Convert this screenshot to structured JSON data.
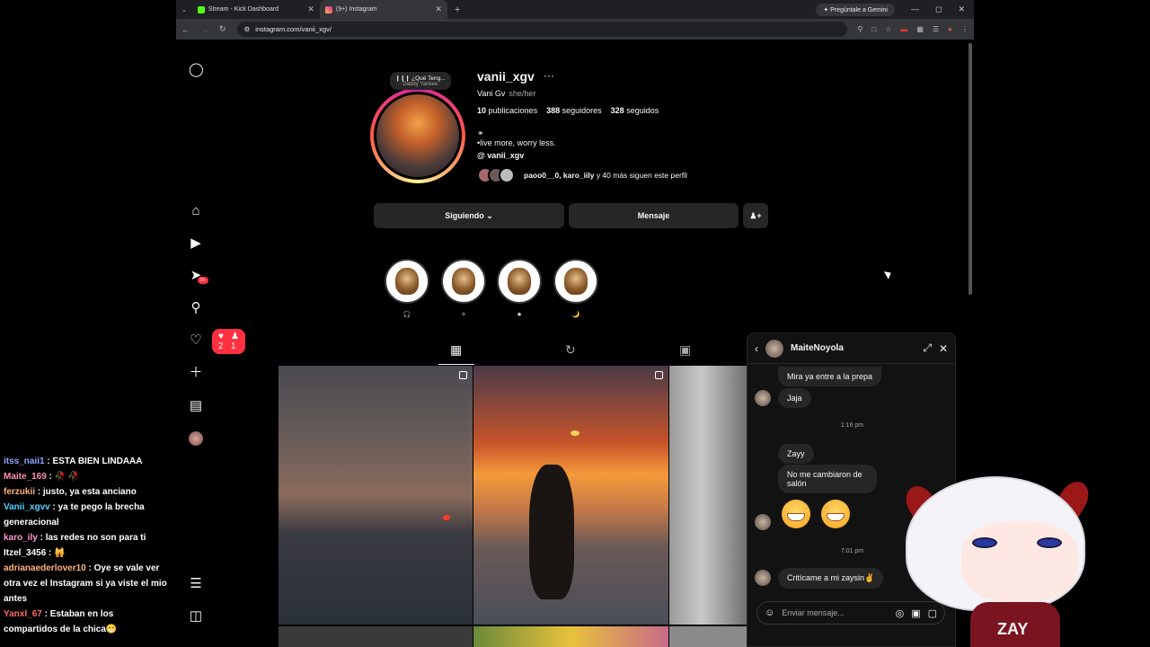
{
  "chat": [
    {
      "user": "itss_naii1",
      "color": "#8fa8ff",
      "text": "ESTA BIEN LINDAAA"
    },
    {
      "user": "Maite_169",
      "color": "#ff8fb3",
      "text": "🥀 🥀"
    },
    {
      "user": "ferzukii",
      "color": "#ffb37a",
      "text": "justo, ya esta anciano"
    },
    {
      "user": "Vanii_xgvv",
      "color": "#5ad0ff",
      "text": "ya te pego la brecha generacional"
    },
    {
      "user": "karo_ily",
      "color": "#ff9ad5",
      "text": "las redes no son para ti"
    },
    {
      "user": "Itzel_3456",
      "color": "#ffffff",
      "text": "🙀"
    },
    {
      "user": "adrianaederlover10",
      "color": "#ffb37a",
      "text": "Oye se vale ver otra vez el Instagram si ya viste el mio antes"
    },
    {
      "user": "Yanxl_67",
      "color": "#ff6b6b",
      "text": "Estaban en los compartidos de la chica😁"
    }
  ],
  "browser": {
    "tabs": [
      {
        "label": "Stream - Kick Dashboard"
      },
      {
        "label": "(9+) Instagram"
      }
    ],
    "new_tab": "+",
    "gemini_label": "Pregúntale a Gemini",
    "url": "instagram.com/vanii_xgv/"
  },
  "nav": {
    "notif_badge": "9+",
    "pill_likes": "2",
    "pill_follows": "1"
  },
  "profile": {
    "note_title": "❙❙❙ ¿Qué Teng...",
    "note_artist": "Daddy Yankee",
    "username": "vanii_xgv",
    "more": "···",
    "name": "Vani Gv",
    "pronouns": "she/her",
    "posts_count": "10",
    "posts_label": "publicaciones",
    "followers_count": "388",
    "followers_label": "seguidores",
    "following_count": "328",
    "following_label": "seguidos",
    "bio": "•live more, worry less.",
    "threads_handle": "vanii_xgv",
    "followed_by": "paoo0__0, karo_iily",
    "followed_by_rest": "y 40 más siguen este perfil",
    "btn_following": "Siguiendo ⌄",
    "btn_message": "Mensaje"
  },
  "highlights": [
    {
      "label": "🎧"
    },
    {
      "label": "✧"
    },
    {
      "label": "★"
    },
    {
      "label": "🌙"
    }
  ],
  "dm": {
    "name": "MaiteNoyola",
    "messages": [
      {
        "text": "Mira ya entre a la prepa"
      },
      {
        "text": "Jaja"
      },
      {
        "text": "Zayy"
      },
      {
        "text": "No me cambiaron de salón"
      },
      {
        "text": "Critícame a mi zaysin✌️"
      }
    ],
    "time1": "1:16 pm",
    "time2": "7:01 pm",
    "placeholder": "Enviar mensaje..."
  },
  "vtuber_label": "ZAY"
}
